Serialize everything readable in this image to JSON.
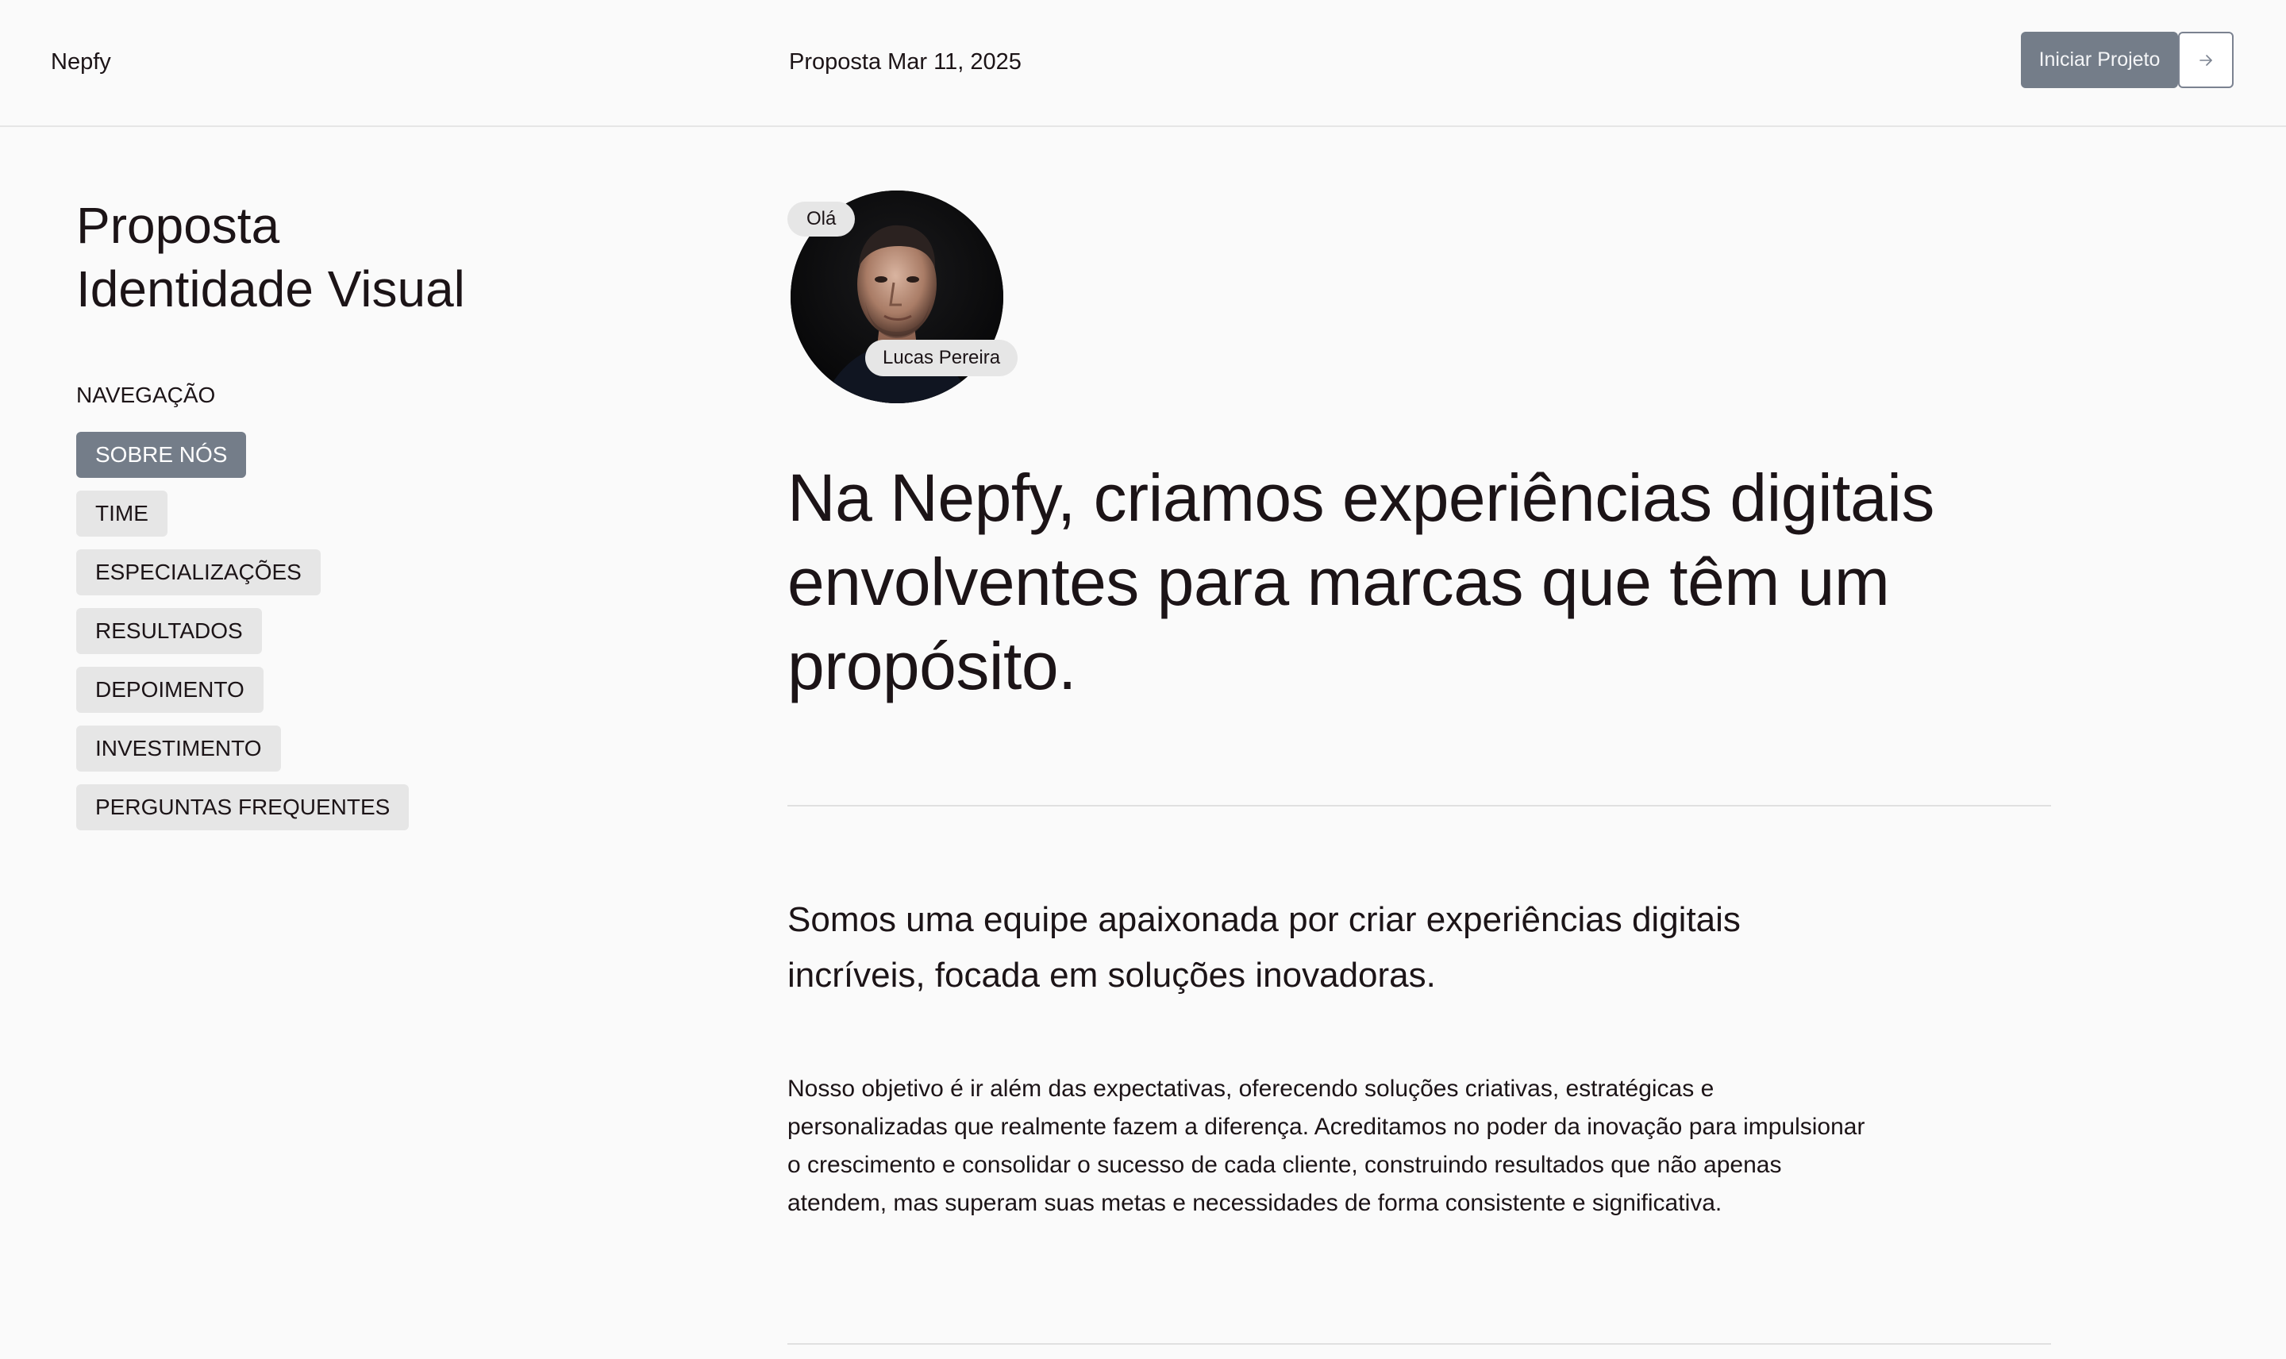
{
  "header": {
    "brand": "Nepfy",
    "doc_label": "Proposta Mar 11, 2025",
    "start_button": "Iniciar Projeto",
    "arrow_icon": "arrow-right-icon"
  },
  "sidebar": {
    "title_line1": "Proposta",
    "title_line2": "Identidade Visual",
    "nav_heading": "NAVEGAÇÃO",
    "items": [
      {
        "label": "SOBRE NÓS",
        "active": true
      },
      {
        "label": "TIME",
        "active": false
      },
      {
        "label": "ESPECIALIZAÇÕES",
        "active": false
      },
      {
        "label": "RESULTADOS",
        "active": false
      },
      {
        "label": "DEPOIMENTO",
        "active": false
      },
      {
        "label": "INVESTIMENTO",
        "active": false
      },
      {
        "label": "PERGUNTAS FREQUENTES",
        "active": false
      }
    ]
  },
  "hero": {
    "greeting": "Olá",
    "person_name": "Lucas Pereira",
    "headline": "Na Nepfy, criamos experiências digitais envolventes para marcas que têm um propósito."
  },
  "about": {
    "lead": "Somos uma equipe apaixonada por criar experiências digitais incríveis, focada em soluções inovadoras.",
    "body": "Nosso objetivo é ir além das expectativas, oferecendo soluções criativas, estratégicas e personalizadas que realmente fazem a diferença. Acreditamos no poder da inovação para impulsionar o crescimento e consolidar o sucesso de cada cliente, construindo resultados que não apenas atendem, mas superam suas metas e necessidades de forma consistente e significativa."
  },
  "colors": {
    "accent": "#747d89",
    "pill_bg": "#e6e6e6",
    "text": "#1c1417",
    "background": "#fafafa"
  }
}
